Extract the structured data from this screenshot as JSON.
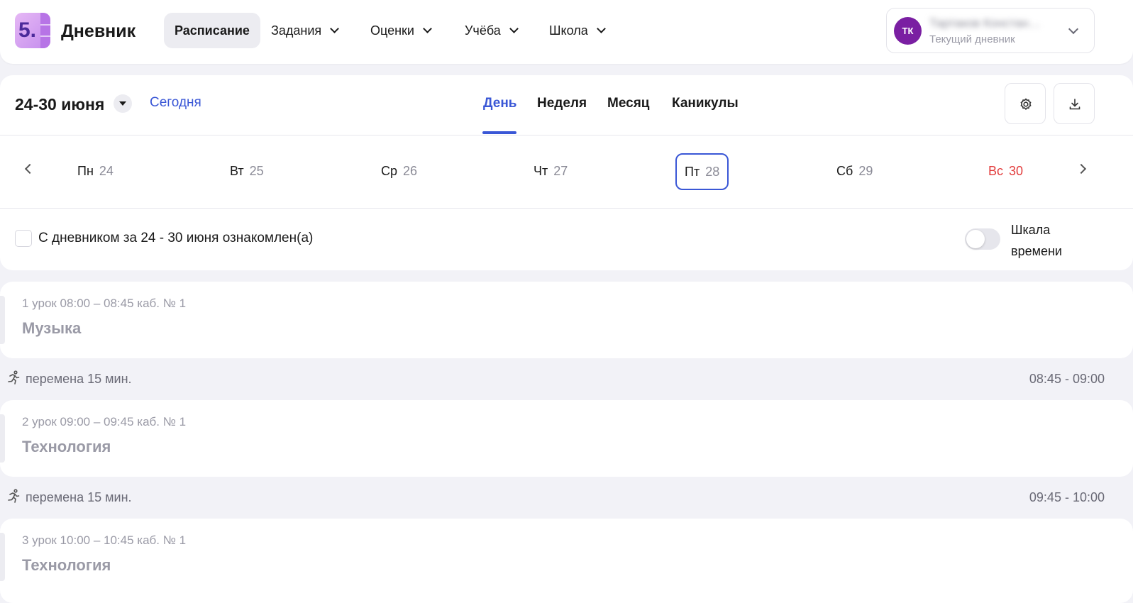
{
  "app": {
    "logo_text": "5.",
    "title": "Дневник"
  },
  "nav": {
    "items": [
      {
        "label": "Расписание",
        "active": true
      },
      {
        "label": "Задания"
      },
      {
        "label": "Оценки"
      },
      {
        "label": "Учёба"
      },
      {
        "label": "Школа"
      }
    ]
  },
  "user": {
    "initials": "ТК",
    "name": "Тартаков Констан…",
    "subtitle": "Текущий дневник"
  },
  "week": {
    "range": "24-30 июня",
    "today_link": "Сегодня",
    "tabs": [
      {
        "label": "День",
        "active": true
      },
      {
        "label": "Неделя"
      },
      {
        "label": "Месяц"
      },
      {
        "label": "Каникулы"
      }
    ],
    "days": [
      {
        "name": "Пн",
        "num": "24"
      },
      {
        "name": "Вт",
        "num": "25"
      },
      {
        "name": "Ср",
        "num": "26"
      },
      {
        "name": "Чт",
        "num": "27"
      },
      {
        "name": "Пт",
        "num": "28",
        "selected": true
      },
      {
        "name": "Сб",
        "num": "29"
      },
      {
        "name": "Вс",
        "num": "30",
        "weekend": true
      }
    ],
    "acknowledge_text": "С дневником за 24 - 30 июня ознакомлен(а)",
    "acknowledged": false,
    "timeline_label_1": "Шкала",
    "timeline_label_2": "времени",
    "timeline_enabled": false
  },
  "schedule": {
    "lessons": [
      {
        "meta": "1 урок 08:00 – 08:45 каб. № 1",
        "subject": "Музыка"
      },
      {
        "meta": "2 урок 09:00 – 09:45 каб. № 1",
        "subject": "Технология"
      },
      {
        "meta": "3 урок 10:00 – 10:45 каб. № 1",
        "subject": "Технология"
      }
    ],
    "breaks": [
      {
        "text": "перемена 15 мин.",
        "time": "08:45 - 09:00"
      },
      {
        "text": "перемена 15 мин.",
        "time": "09:45 - 10:00"
      }
    ]
  },
  "colors": {
    "accent": "#3a57d6",
    "weekend": "#e23b3b",
    "avatar": "#7a1fa2",
    "background": "#f2f2f7"
  }
}
